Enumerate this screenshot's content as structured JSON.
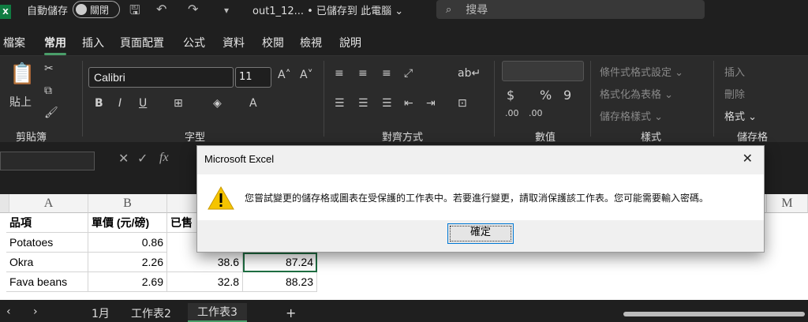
{
  "titlebar": {
    "app_icon": "X",
    "autosave_label": "自動儲存",
    "autosave_toggle": "關閉",
    "filename": "out1_12...  •  已儲存到 此電腦 ⌄",
    "search_placeholder": "搜尋"
  },
  "ribbon_tabs": [
    "檔案",
    "常用",
    "插入",
    "頁面配置",
    "公式",
    "資料",
    "校閱",
    "檢視",
    "說明"
  ],
  "ribbon": {
    "groups": [
      "剪貼簿",
      "字型",
      "對齊方式",
      "數值",
      "樣式",
      "儲存格"
    ],
    "paste_label": "貼上",
    "font_name": "Calibri",
    "font_size": "11",
    "conditional_format": "條件式格式設定 ⌄",
    "format_as_table": "格式化為表格 ⌄",
    "cell_styles": "儲存格樣式 ⌄",
    "insert": "插入",
    "delete": "刪除",
    "format": "格式 ⌄"
  },
  "formula_bar": {
    "fx": "fx"
  },
  "sheet": {
    "columns": [
      "A",
      "B",
      "M"
    ],
    "header_row": [
      "品項",
      "單價 (元/磅)",
      "已售"
    ],
    "rows": [
      {
        "a": "Potatoes",
        "b": "0.86",
        "c": "",
        "d": ""
      },
      {
        "a": "Okra",
        "b": "2.26",
        "c": "38.6",
        "d": "87.24"
      },
      {
        "a": "Fava beans",
        "b": "2.69",
        "c": "32.8",
        "d": "88.23"
      }
    ]
  },
  "sheet_tabs": [
    "1月",
    "工作表2",
    "工作表3"
  ],
  "add_sheet": "+",
  "dialog": {
    "title": "Microsoft Excel",
    "message": "您嘗試變更的儲存格或圖表在受保護的工作表中。若要進行變更，請取消保護該工作表。您可能需要輸入密碼。",
    "ok_label": "確定",
    "icon": "warning-icon"
  }
}
